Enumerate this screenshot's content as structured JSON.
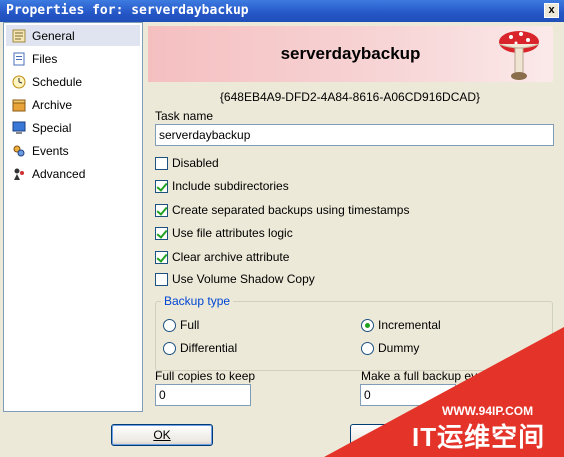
{
  "window": {
    "title": "Properties for: serverdaybackup",
    "close_label": "x"
  },
  "sidebar": {
    "items": [
      {
        "label": "General",
        "icon": "general-icon"
      },
      {
        "label": "Files",
        "icon": "files-icon"
      },
      {
        "label": "Schedule",
        "icon": "clock-icon"
      },
      {
        "label": "Archive",
        "icon": "archive-icon"
      },
      {
        "label": "Special",
        "icon": "computer-icon"
      },
      {
        "label": "Events",
        "icon": "events-icon"
      },
      {
        "label": "Advanced",
        "icon": "advanced-icon"
      }
    ]
  },
  "header": {
    "task_title": "serverdaybackup",
    "guid": "{648EB4A9-DFD2-4A84-8616-A06CD916DCAD}"
  },
  "task": {
    "label": "Task name",
    "value": "serverdaybackup"
  },
  "options": [
    {
      "label": "Disabled",
      "checked": false
    },
    {
      "label": "Include subdirectories",
      "checked": true
    },
    {
      "label": "Create separated backups using timestamps",
      "checked": true
    },
    {
      "label": "Use file attributes logic",
      "checked": true
    },
    {
      "label": "Clear archive attribute",
      "checked": true
    },
    {
      "label": "Use Volume Shadow Copy",
      "checked": false
    }
  ],
  "backup_type": {
    "title": "Backup type",
    "options": [
      {
        "label": "Full",
        "selected": false
      },
      {
        "label": "Incremental",
        "selected": true
      },
      {
        "label": "Differential",
        "selected": false
      },
      {
        "label": "Dummy",
        "selected": false
      }
    ]
  },
  "full_copies": {
    "label": "Full copies to keep",
    "value": "0"
  },
  "full_every": {
    "label": "Make a full backup every",
    "value": "0"
  },
  "buttons": {
    "ok": "OK"
  },
  "watermark": {
    "url": "WWW.94IP.COM",
    "brand": "IT运维空间"
  },
  "colors": {
    "titlebar": "#2556c7",
    "banner": "#f5bfc0",
    "accent": "#21a121",
    "watermark": "#e4342a"
  }
}
